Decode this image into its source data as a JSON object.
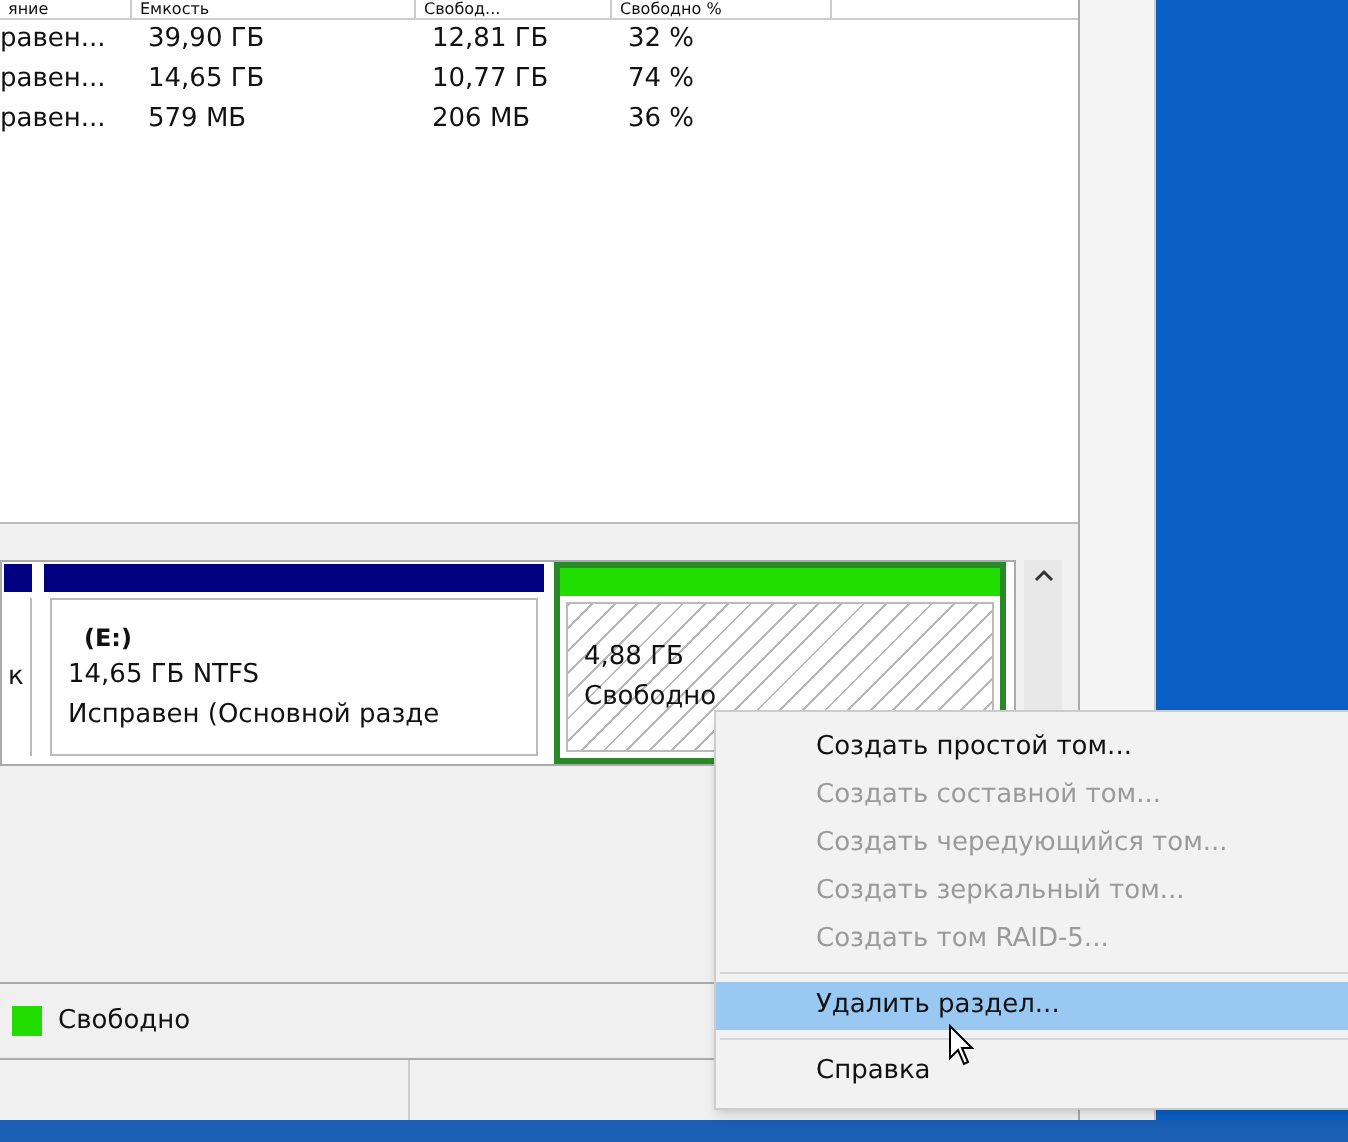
{
  "table": {
    "columns": [
      "яние",
      "Емкость",
      "Свобод...",
      "Свободно %"
    ],
    "rows": [
      [
        "равен...",
        "39,90 ГБ",
        "12,81 ГБ",
        "32 %"
      ],
      [
        "равен...",
        "14,65 ГБ",
        "10,77 ГБ",
        "74 %"
      ],
      [
        "равен...",
        "579 МБ",
        "206 МБ",
        "36 %"
      ]
    ]
  },
  "disk_map": {
    "partitions": [
      {
        "kind": "volume",
        "lines": [
          "к"
        ],
        "color": "#000080",
        "selected": false
      },
      {
        "kind": "volume",
        "title": "(E:)",
        "lines": [
          "14,65 ГБ NTFS",
          "Исправен (Основной разде"
        ],
        "color": "#000080",
        "selected": false
      },
      {
        "kind": "unallocated",
        "lines": [
          "4,88 ГБ",
          "Свободно"
        ],
        "color": "#22dd00",
        "selected": true
      }
    ]
  },
  "legend": [
    {
      "label": "Свободно",
      "color": "#22dd00"
    }
  ],
  "context_menu": {
    "items": [
      {
        "kind": "item",
        "label": "Создать простой том...",
        "disabled": false,
        "selected": false
      },
      {
        "kind": "item",
        "label": "Создать составной том...",
        "disabled": true,
        "selected": false
      },
      {
        "kind": "item",
        "label": "Создать чередующийся том...",
        "disabled": true,
        "selected": false
      },
      {
        "kind": "item",
        "label": "Создать зеркальный том...",
        "disabled": true,
        "selected": false
      },
      {
        "kind": "item",
        "label": "Создать том RAID-5...",
        "disabled": true,
        "selected": false
      },
      {
        "kind": "separator"
      },
      {
        "kind": "item",
        "label": "Удалить раздел...",
        "disabled": false,
        "selected": true
      },
      {
        "kind": "separator"
      },
      {
        "kind": "item",
        "label": "Справка",
        "disabled": false,
        "selected": false
      }
    ]
  }
}
